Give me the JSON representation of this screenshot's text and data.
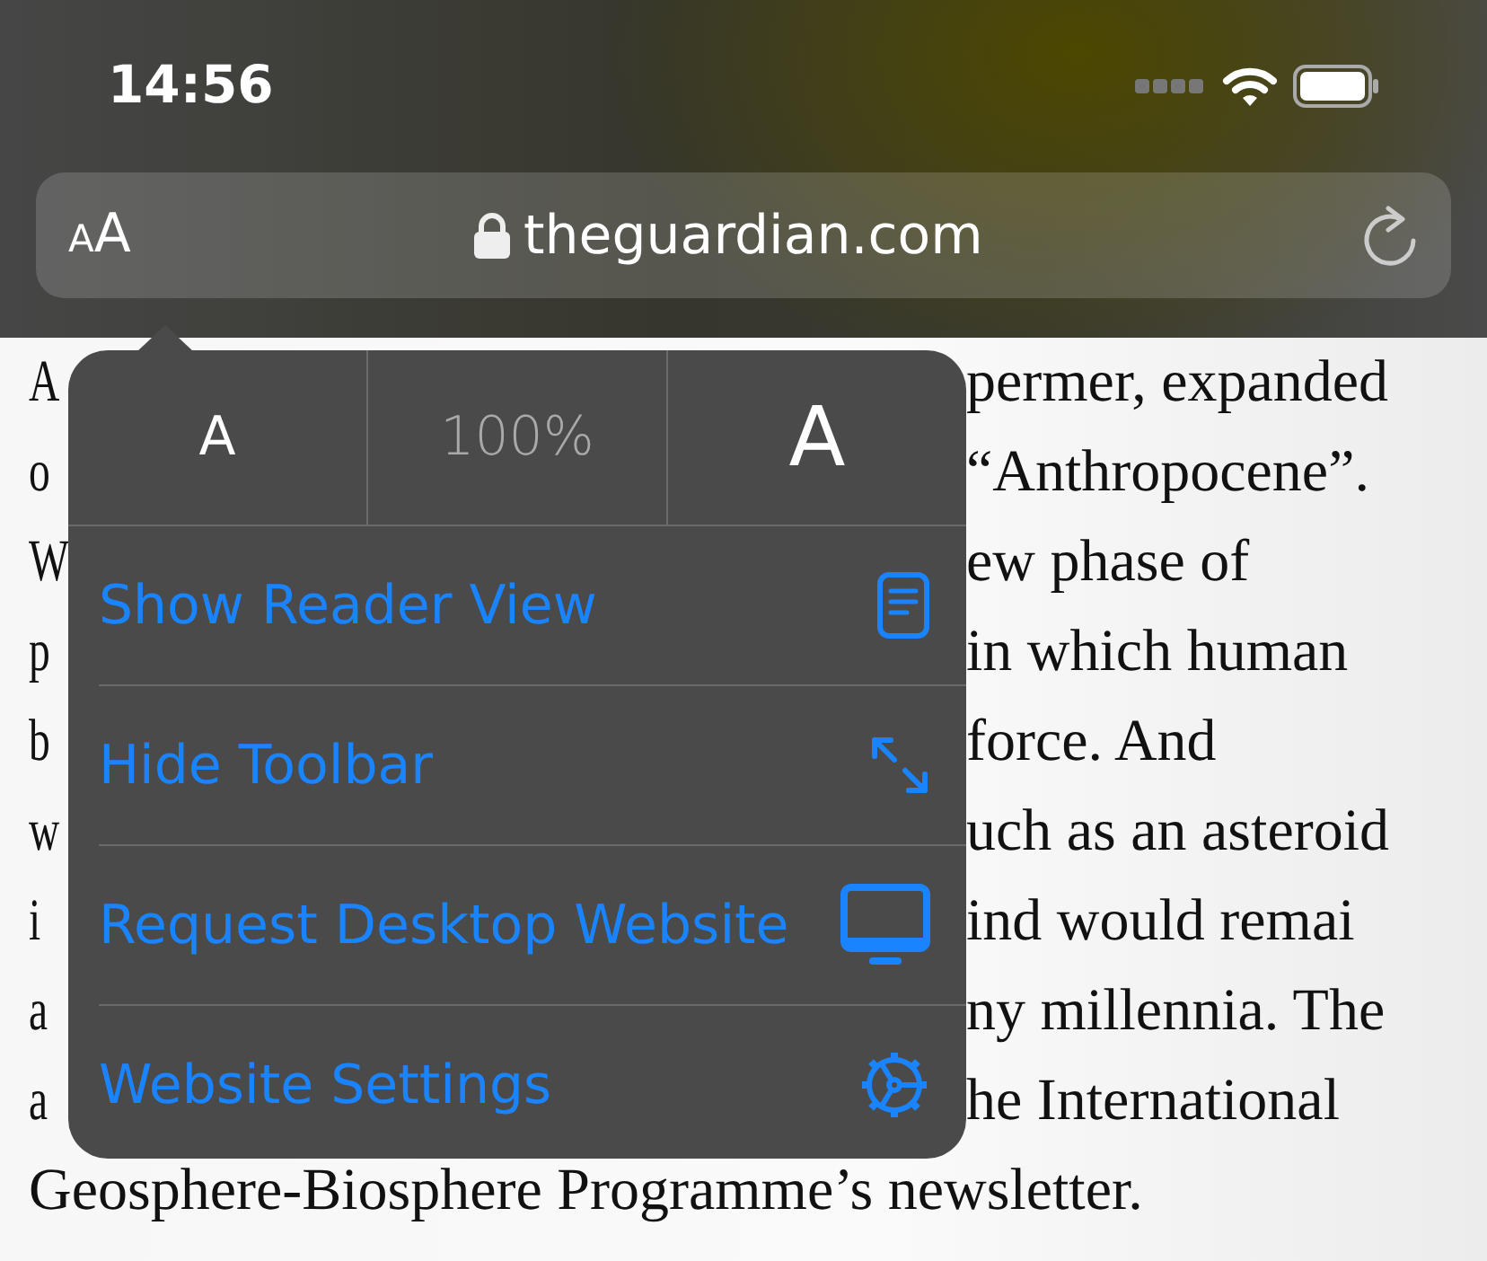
{
  "status_bar": {
    "time": "14:56"
  },
  "address_bar": {
    "text_size_button": {
      "small": "A",
      "large": "A"
    },
    "url": "theguardian.com"
  },
  "article": {
    "lines": [
      {
        "left": "A",
        "right": "permer, expanded"
      },
      {
        "left": "o",
        "right": "“Anthropocene”."
      },
      {
        "left": "W",
        "right": "ew phase of"
      },
      {
        "left": "p",
        "right": "in which human"
      },
      {
        "left": "b",
        "right": "force. And"
      },
      {
        "left": "w",
        "right": "uch as an asteroid"
      },
      {
        "left": "i",
        "right": "ind would remai"
      },
      {
        "left": "a",
        "right": "ny millennia. The"
      },
      {
        "left": "a",
        "right": "he International"
      },
      {
        "left": "Geosphere-Biosphere Programme’s newsletter."
      }
    ]
  },
  "popover": {
    "zoom": {
      "smaller": "A",
      "level": "100%",
      "larger": "A"
    },
    "items": [
      {
        "label": "Show Reader View",
        "kind": "reader"
      },
      {
        "label": "Hide Toolbar",
        "kind": "expand"
      },
      {
        "label": "Request Desktop Website",
        "kind": "desktop"
      },
      {
        "label": "Website Settings",
        "kind": "settings"
      }
    ]
  }
}
